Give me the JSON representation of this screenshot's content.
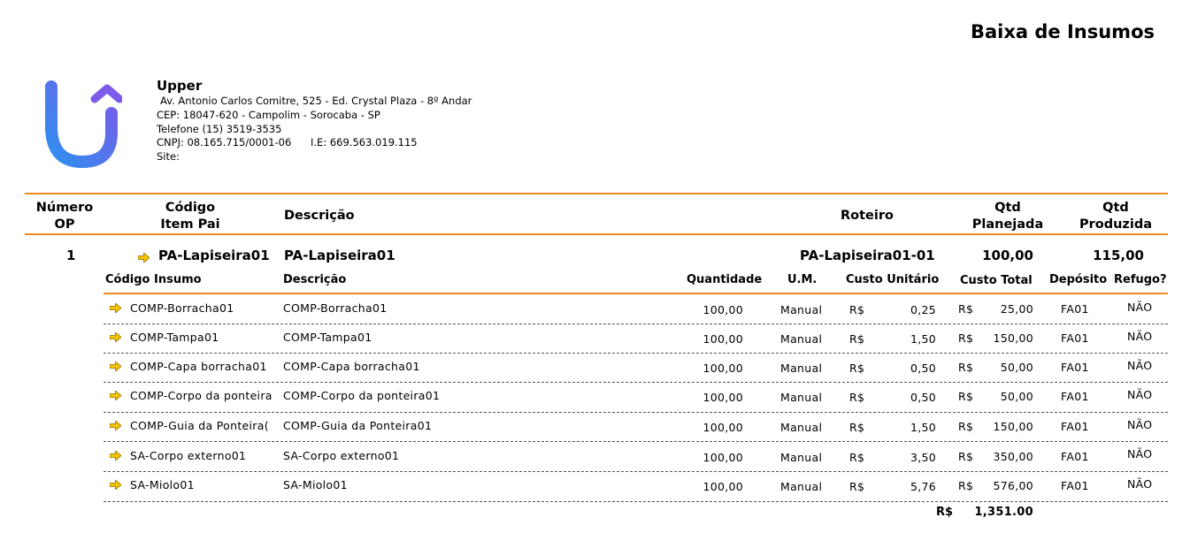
{
  "report": {
    "title": "Baixa de Insumos"
  },
  "company": {
    "name": "Upper",
    "address": "Av. Antonio Carlos Comitre, 525 - Ed. Crystal Plaza - 8º Andar",
    "cep": "CEP: 18047-620 - Campolim - Sorocaba - SP",
    "phone": "Telefone  (15) 3519-3535",
    "cnpj": "CNPJ: 08.165.715/0001-06",
    "ie": "I.E:  669.563.019.115",
    "site": "Site:"
  },
  "main_header": {
    "numero_op": [
      "Número",
      "OP"
    ],
    "codigo_item_pai": [
      "Código",
      "Item Pai"
    ],
    "descricao": "Descrição",
    "roteiro": "Roteiro",
    "qtd_planejada": [
      "Qtd",
      "Planejada"
    ],
    "qtd_produzida": [
      "Qtd",
      "Produzida"
    ]
  },
  "op": {
    "numero": "1",
    "codigo": "PA-Lapiseira01",
    "descricao": "PA-Lapiseira01",
    "roteiro": "PA-Lapiseira01-01",
    "qtd_planejada": "100,00",
    "qtd_produzida": "115,00"
  },
  "sub_header": {
    "codigo_insumo": "Código Insumo",
    "descricao": "Descrição",
    "quantidade": "Quantidade",
    "um": "U.M.",
    "custo_unitario": "Custo Unitário",
    "custo_total": "Custo Total",
    "deposito": "Depósito",
    "refugo": "Refugo?"
  },
  "items": [
    {
      "codigo": "COMP-Borracha01",
      "descricao": "COMP-Borracha01",
      "quantidade": "100,00",
      "um": "Manual",
      "moeda_unit": "R$",
      "custo_unit": "0,25",
      "moeda_total": "R$",
      "custo_total": "25,00",
      "deposito": "FA01",
      "refugo": "NÃO"
    },
    {
      "codigo": "COMP-Tampa01",
      "descricao": "COMP-Tampa01",
      "quantidade": "100,00",
      "um": "Manual",
      "moeda_unit": "R$",
      "custo_unit": "1,50",
      "moeda_total": "R$",
      "custo_total": "150,00",
      "deposito": "FA01",
      "refugo": "NÃO"
    },
    {
      "codigo": "COMP-Capa borracha01",
      "descricao": "COMP-Capa borracha01",
      "quantidade": "100,00",
      "um": "Manual",
      "moeda_unit": "R$",
      "custo_unit": "0,50",
      "moeda_total": "R$",
      "custo_total": "50,00",
      "deposito": "FA01",
      "refugo": "NÃO"
    },
    {
      "codigo": "COMP-Corpo da ponteira",
      "descricao": "COMP-Corpo da ponteira01",
      "quantidade": "100,00",
      "um": "Manual",
      "moeda_unit": "R$",
      "custo_unit": "0,50",
      "moeda_total": "R$",
      "custo_total": "50,00",
      "deposito": "FA01",
      "refugo": "NÃO"
    },
    {
      "codigo": "COMP-Guia da Ponteira(",
      "descricao": "COMP-Guia da Ponteira01",
      "quantidade": "100,00",
      "um": "Manual",
      "moeda_unit": "R$",
      "custo_unit": "1,50",
      "moeda_total": "R$",
      "custo_total": "150,00",
      "deposito": "FA01",
      "refugo": "NÃO"
    },
    {
      "codigo": "SA-Corpo externo01",
      "descricao": "SA-Corpo externo01",
      "quantidade": "100,00",
      "um": "Manual",
      "moeda_unit": "R$",
      "custo_unit": "3,50",
      "moeda_total": "R$",
      "custo_total": "350,00",
      "deposito": "FA01",
      "refugo": "NÃO"
    },
    {
      "codigo": "SA-Miolo01",
      "descricao": "SA-Miolo01",
      "quantidade": "100,00",
      "um": "Manual",
      "moeda_unit": "R$",
      "custo_unit": "5,76",
      "moeda_total": "R$",
      "custo_total": "576,00",
      "deposito": "FA01",
      "refugo": "NÃO"
    }
  ],
  "total": {
    "currency": "R$",
    "value": "1,351.00"
  },
  "icons": {
    "row_marker": "right-arrow-icon",
    "logo": "upper-logo-icon"
  },
  "colors": {
    "accent": "#f08a1c",
    "arrow": "#f5c400",
    "logo_start": "#2f8ff0",
    "logo_end": "#7b5be8"
  }
}
